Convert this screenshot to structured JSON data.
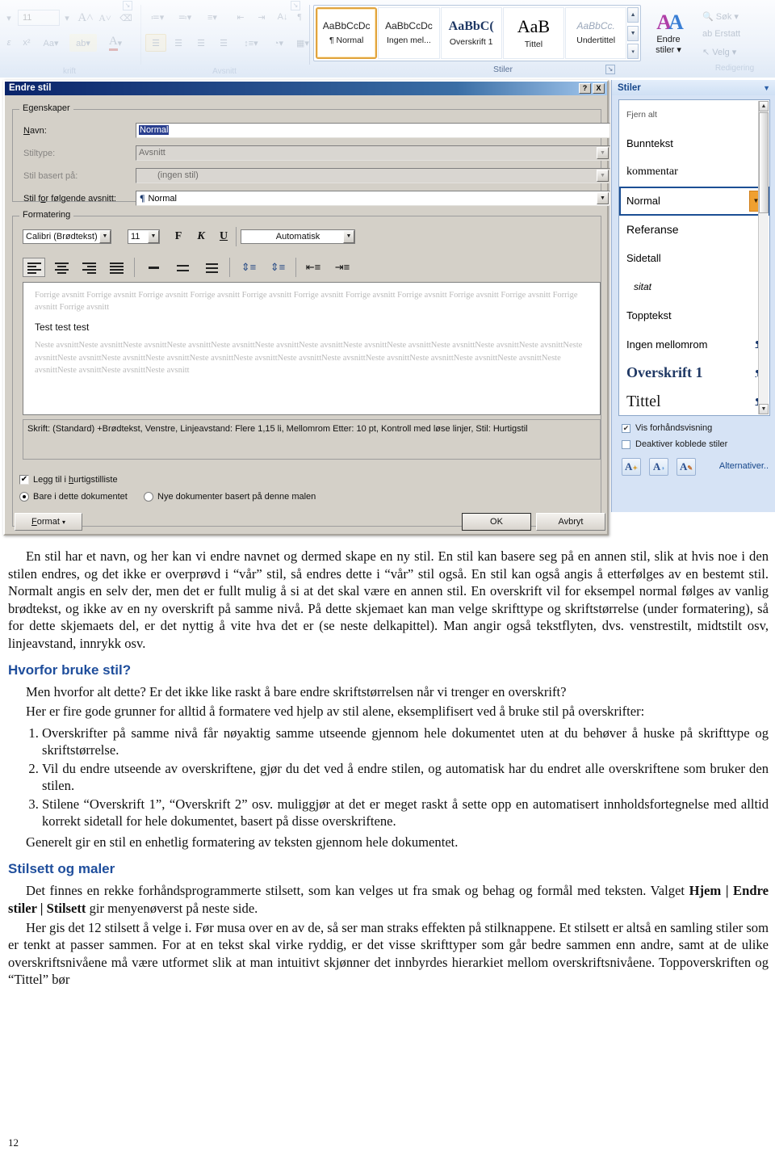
{
  "ribbon": {
    "font_size_value": "11",
    "groups": {
      "skrift": "krift",
      "avsnitt": "Avsnitt",
      "stiler": "Stiler",
      "redigering": "Redigering"
    },
    "gallery": [
      {
        "preview": "AaBbCcDc",
        "name": "¶ Normal",
        "selected": true
      },
      {
        "preview": "AaBbCcDc",
        "name": "Ingen mel...",
        "selected": false
      },
      {
        "preview": "AaBbC(",
        "name": "Overskrift 1",
        "selected": false
      },
      {
        "preview": "AaB",
        "name": "Tittel",
        "selected": false
      },
      {
        "preview": "AaBbCc.",
        "name": "Undertittel",
        "selected": false
      }
    ],
    "endre_stiler": "Endre\nstiler",
    "endre_stiler_line1": "Endre",
    "endre_stiler_line2": "stiler",
    "editing": [
      {
        "label": "Søk",
        "icon": "binoculars-icon"
      },
      {
        "label": "Erstatt",
        "icon": "replace-icon"
      },
      {
        "label": "Velg",
        "icon": "select-icon"
      }
    ]
  },
  "dialog": {
    "title": "Endre stil",
    "help_button": "?",
    "close_button": "X",
    "groups": {
      "properties": "Egenskaper",
      "formatting": "Formatering"
    },
    "fields": [
      {
        "label": "Navn:",
        "value": "Normal",
        "type": "text",
        "disabled": false
      },
      {
        "label": "Stiltype:",
        "value": "Avsnitt",
        "type": "combo",
        "disabled": true
      },
      {
        "label": "Stil basert på:",
        "value": "(ingen stil)",
        "type": "combo",
        "disabled": true
      },
      {
        "label": "Stil for følgende avsnitt:",
        "value": "Normal",
        "type": "combo",
        "disabled": false
      }
    ],
    "formatting": {
      "font_family": "Calibri (Brødtekst)",
      "font_size": "11",
      "bold": "F",
      "italic": "K",
      "underline": "U",
      "color": "Automatisk"
    },
    "preview": {
      "before": "Forrige avsnitt Forrige avsnitt Forrige avsnitt Forrige avsnitt Forrige avsnitt Forrige avsnitt Forrige avsnitt Forrige avsnitt Forrige avsnitt Forrige avsnitt Forrige avsnitt Forrige avsnitt",
      "sample": "Test test test",
      "after": "Neste avsnittNeste avsnittNeste avsnittNeste avsnittNeste avsnittNeste avsnittNeste avsnittNeste avsnittNeste avsnittNeste avsnittNeste avsnittNeste avsnittNeste avsnittNeste avsnittNeste avsnittNeste avsnittNeste avsnittNeste avsnittNeste avsnittNeste avsnittNeste avsnittNeste avsnittNeste avsnittNeste avsnittNeste avsnittNeste avsnittNeste avsnittNeste avsnitt"
    },
    "description": "Skrift: (Standard) +Brødtekst, Venstre, Linjeavstand:  Flere 1,15 li, Mellomrom Etter:  10 pt, Kontroll med løse linjer, Stil: Hurtigstil",
    "quicklist_checkbox": "Legg til i hurtigstilliste",
    "quicklist_checked": true,
    "radio_this_doc": "Bare i dette dokumentet",
    "radio_new_docs": "Nye dokumenter basert på denne malen",
    "radio_selected": "this_doc",
    "format_button": "Format",
    "ok_button": "OK",
    "cancel_button": "Avbryt"
  },
  "pane": {
    "title": "Stiler",
    "styles": [
      {
        "name": "Fjern alt",
        "mark": "",
        "kind": "clear",
        "selected": false
      },
      {
        "name": "Bunntekst",
        "mark": "¶",
        "kind": "paragraph",
        "selected": false
      },
      {
        "name": "kommentar",
        "mark": "¶",
        "kind": "paragraph",
        "selected": false
      },
      {
        "name": "Normal",
        "mark": "",
        "kind": "paragraph",
        "selected": true
      },
      {
        "name": "Referanse",
        "mark": "¶",
        "kind": "paragraph",
        "selected": false
      },
      {
        "name": "Sidetall",
        "mark": "a",
        "kind": "character",
        "selected": false
      },
      {
        "name": "sitat",
        "mark": "¶",
        "kind": "paragraph",
        "selected": false
      },
      {
        "name": "Topptekst",
        "mark": "¶",
        "kind": "paragraph",
        "selected": false
      },
      {
        "name": "Ingen mellomrom",
        "mark": "¶a",
        "kind": "linked",
        "selected": false
      },
      {
        "name": "Overskrift 1",
        "mark": "¶a",
        "kind": "linked",
        "selected": false
      },
      {
        "name": "Tittel",
        "mark": "¶a",
        "kind": "linked",
        "selected": false
      }
    ],
    "show_preview_label": "Vis forhåndsvisning",
    "show_preview_checked": true,
    "disable_linked_label": "Deaktiver koblede stiler",
    "disable_linked_checked": false,
    "buttons": [
      {
        "icon": "new-style-icon",
        "glyph": "A"
      },
      {
        "icon": "style-inspector-icon",
        "glyph": "A"
      },
      {
        "icon": "manage-styles-icon",
        "glyph": "A"
      }
    ],
    "options_link": "Alternativer.."
  },
  "document": {
    "paragraphs": [
      "En stil har et navn, og her kan vi endre navnet og dermed skape en ny stil. En stil kan basere seg på en annen stil, slik at hvis noe i den stilen endres, og det ikke er overprøvd i “vår” stil, så endres dette i “vår” stil også. En stil kan også angis å etterfølges av en bestemt stil. Normalt angis en selv der, men det er fullt mulig å si at det skal være en annen stil. En overskrift vil for eksempel normal følges av vanlig brødtekst, og ikke av en ny overskrift på samme nivå. På dette skjemaet kan man velge skrifttype og skriftstørrelse (under formatering), så for dette skjemaets del, er det nyttig å vite hva det er (se neste delkapittel). Man angir også tekstflyten, dvs. venstrestilt, midtstilt osv, linjeavstand, innrykk osv."
    ],
    "heading1": "Hvorfor bruke stil?",
    "p_after_h1_a": "Men hvorfor alt dette? Er det ikke like raskt å bare endre skriftstørrelsen når vi trenger en overskrift?",
    "p_after_h1_b": "Her er fire gode grunner for alltid å formatere ved hjelp av stil alene, eksemplifisert ved å bruke stil på overskrifter:",
    "list": [
      "Overskrifter på samme nivå får nøyaktig samme utseende gjennom hele dokumentet uten at du behøver å huske på skrifttype og skriftstørrelse.",
      "Vil du endre utseende av overskriftene, gjør du det ved å endre stilen, og automatisk har du endret alle overskriftene som bruker den stilen.",
      "Stilene “Overskrift 1”, “Overskrift 2” osv. muliggjør at det er meget raskt å sette opp en automatisert innholdsfortegnelse med alltid korrekt sidetall for hele dokumentet, basert på disse overskriftene."
    ],
    "p_general": "Generelt gir en stil en enhetlig formatering av teksten gjennom hele dokumentet.",
    "heading2": "Stilsett og maler",
    "p_stilsett_1_pre": "Det finnes en rekke forhåndsprogrammerte stilsett, som kan velges ut fra smak og behag og formål med teksten. Valget ",
    "p_stilsett_1_bold": "Hjem | Endre stiler | Stilsett",
    "p_stilsett_1_post": " gir menyenøverst på neste side.",
    "p_stilsett_2": "Her gis det 12 stilsett å velge i. Før musa over en av de, så ser man straks effekten på stilknappene. Et stilsett er altså en samling stiler som er tenkt at passer sammen. For at en tekst skal virke ryddig, er det visse skrifttyper som går bedre sammen enn andre, samt at de ulike overskriftsnivåene må være utformet slik at man intuitivt skjønner det innbyrdes hierarkiet mellom overskriftsnivåene. Toppoverskriften og “Tittel” bør",
    "page_number": "12"
  }
}
